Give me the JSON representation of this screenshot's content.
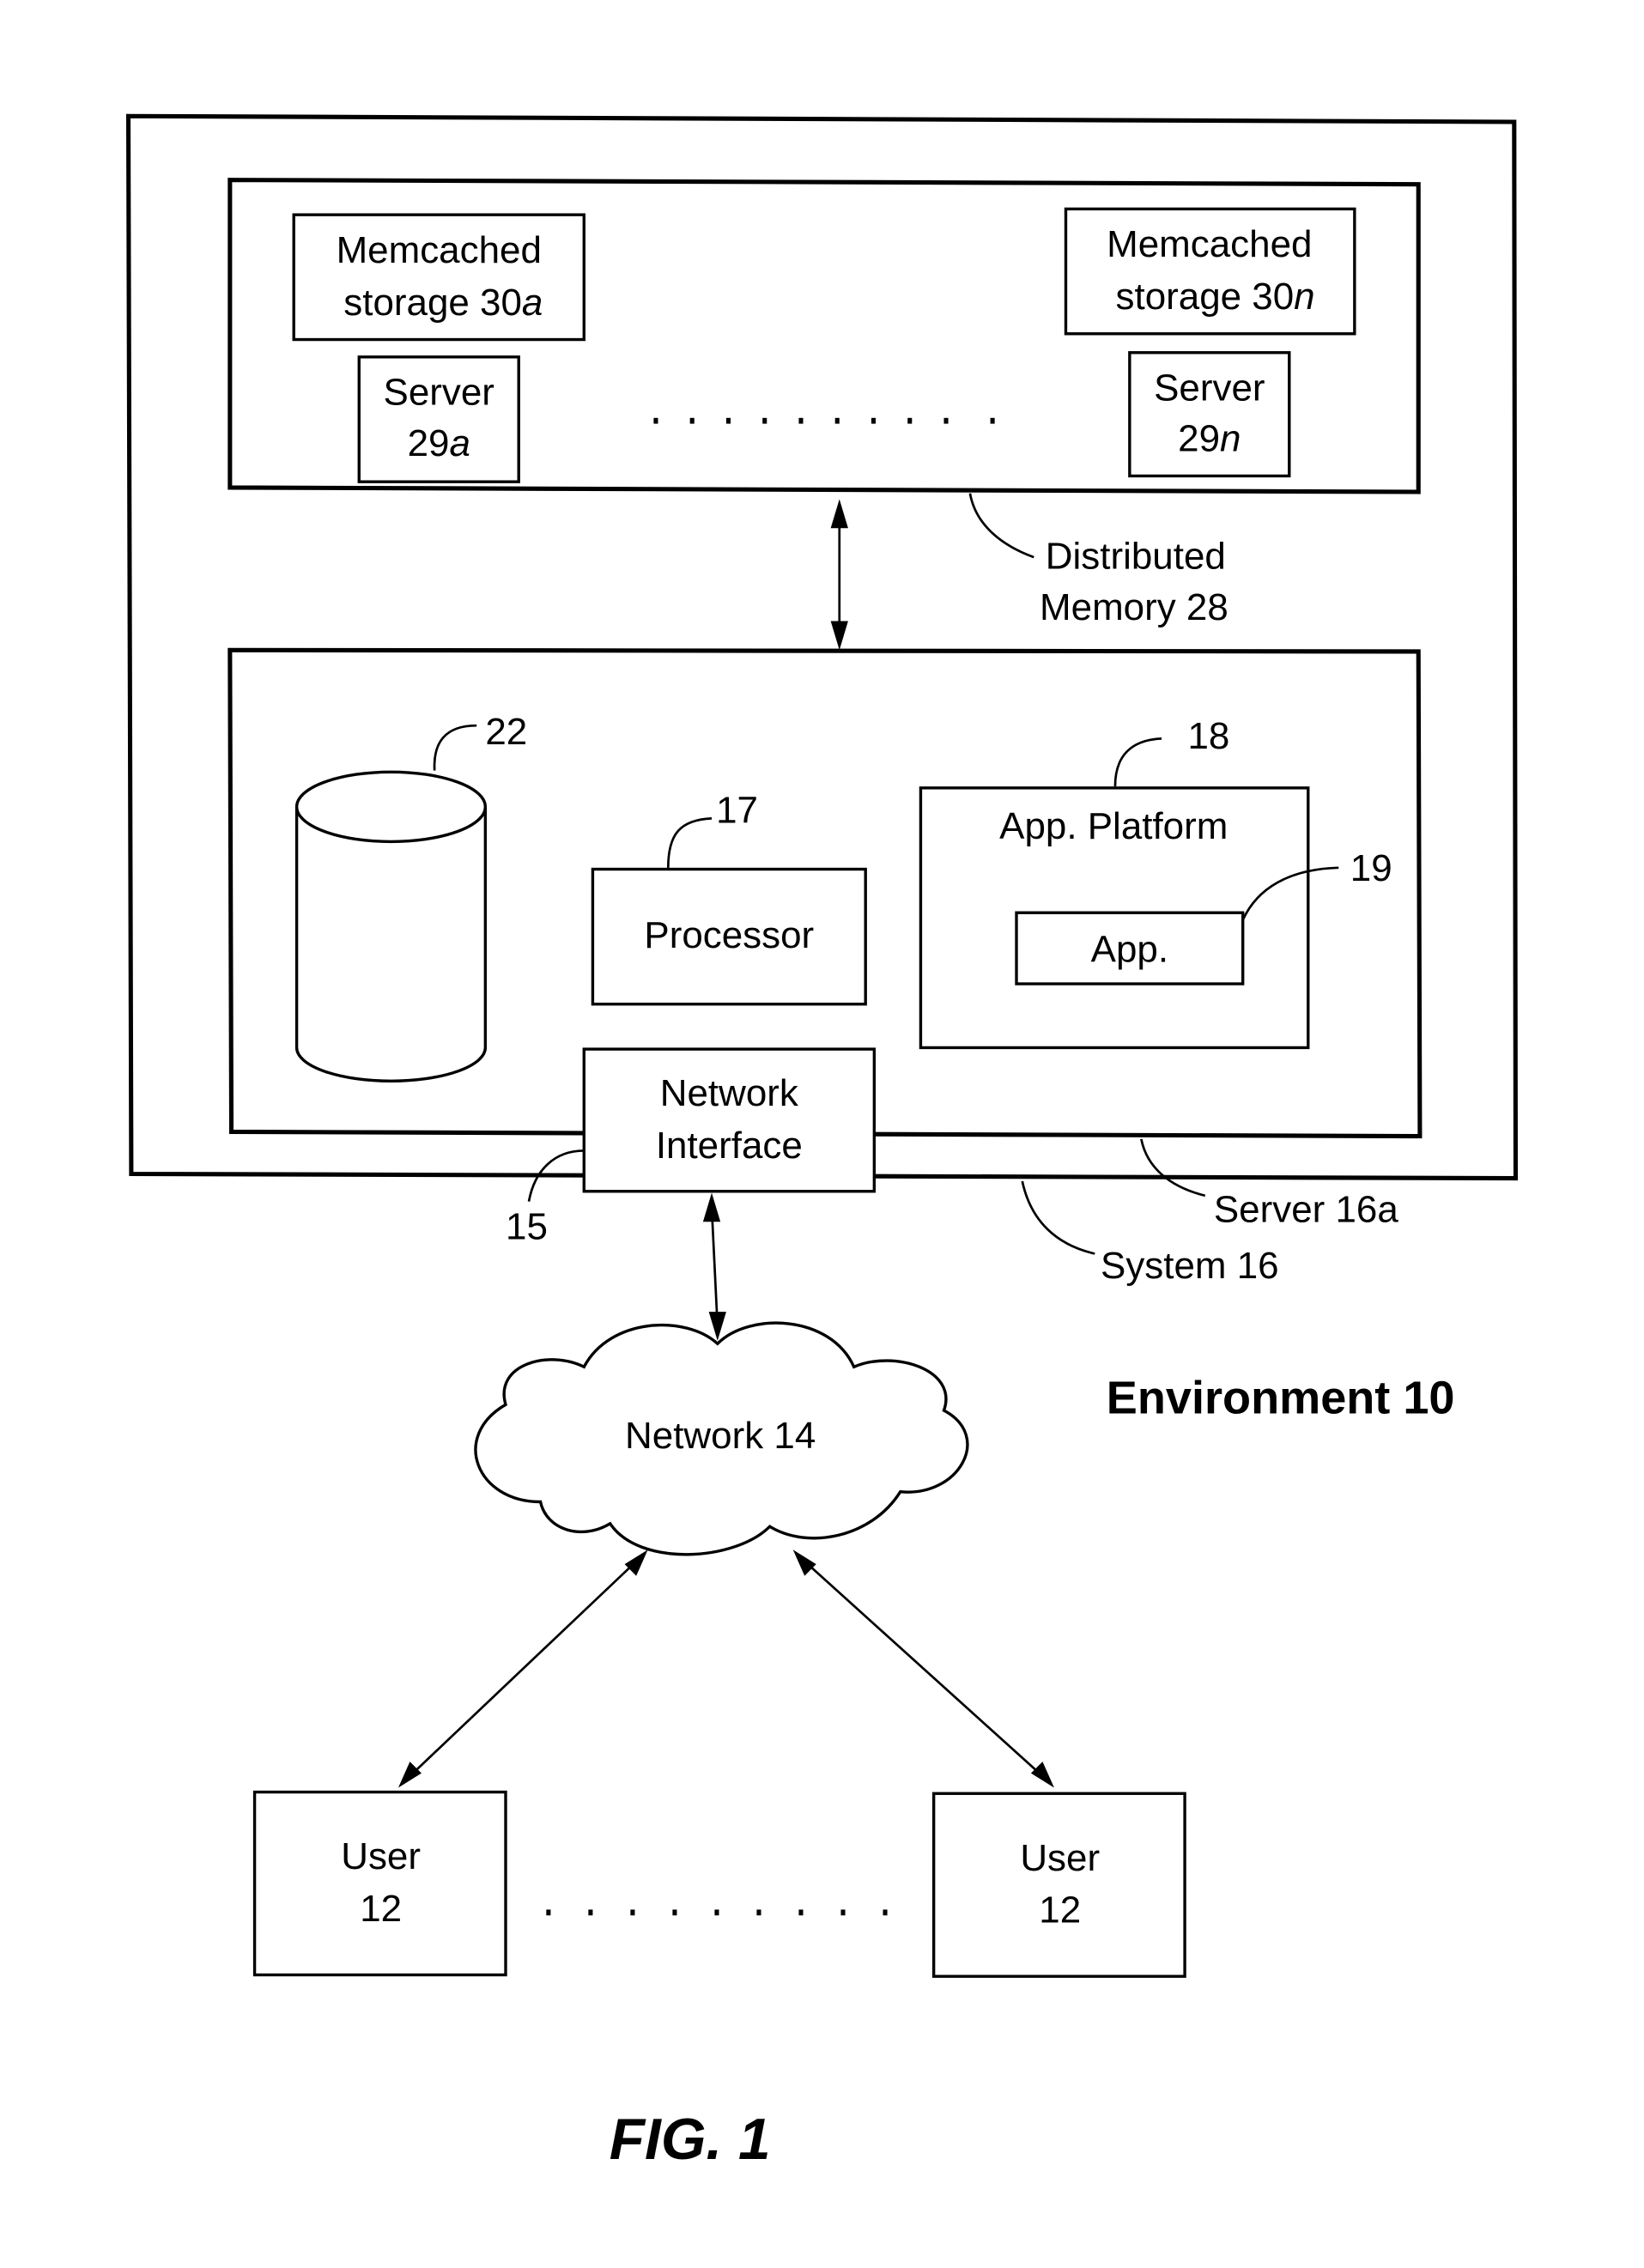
{
  "figure": {
    "caption": "FIG. 1",
    "environment_label": "Environment 10"
  },
  "distributed_memory": {
    "label_line1": "Distributed",
    "label_line2": "Memory 28",
    "storage_a": {
      "line1": "Memcached",
      "line2_prefix": "storage 30",
      "line2_suffix": "a"
    },
    "storage_n": {
      "line1": "Memcached",
      "line2_prefix": "storage 30",
      "line2_suffix": "n"
    },
    "server_a": {
      "line1": "Server",
      "line2_prefix": "29",
      "line2_suffix": "a"
    },
    "server_n": {
      "line1": "Server",
      "line2_prefix": "29",
      "line2_suffix": "n"
    }
  },
  "server": {
    "label": "Server 16a",
    "database_ref": "22",
    "processor": {
      "label": "Processor",
      "ref": "17"
    },
    "app_platform": {
      "label": "App. Platform",
      "ref": "18"
    },
    "app": {
      "label": "App.",
      "ref": "19"
    },
    "network_interface": {
      "line1": "Network",
      "line2": "Interface",
      "ref": "15"
    }
  },
  "system": {
    "label": "System 16"
  },
  "network": {
    "label": "Network 14"
  },
  "users": [
    {
      "line1": "User",
      "line2": "12"
    },
    {
      "line1": "User",
      "line2": "12"
    }
  ]
}
